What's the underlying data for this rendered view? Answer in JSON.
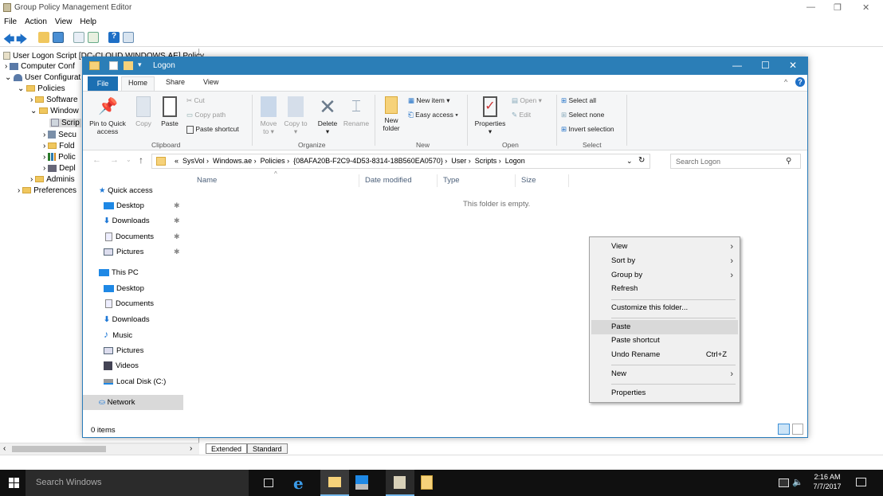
{
  "gpm": {
    "title": "Group Policy Management Editor",
    "menu": [
      "File",
      "Action",
      "View",
      "Help"
    ],
    "tree": {
      "root": "User Logon Script [DC-CLOUD.WINDOWS.AE] Policy",
      "computer_config": "Computer Conf",
      "user_config": "User Configurat",
      "policies": "Policies",
      "software": "Software",
      "windows": "Window",
      "scripts": "Scrip",
      "security": "Secu",
      "folder": "Fold",
      "policy": "Polic",
      "deployed": "Depl",
      "admin": "Adminis",
      "preferences": "Preferences"
    },
    "tabs": {
      "extended": "Extended",
      "standard": "Standard"
    }
  },
  "explorer": {
    "title": "Logon",
    "tabs": {
      "file": "File",
      "home": "Home",
      "share": "Share",
      "view": "View"
    },
    "ribbon": {
      "pin": "Pin to Quick access",
      "copy": "Copy",
      "paste": "Paste",
      "cut": "Cut",
      "copy_path": "Copy path",
      "paste_shortcut": "Paste shortcut",
      "move_to": "Move to",
      "copy_to": "Copy to",
      "delete": "Delete",
      "rename": "Rename",
      "new_folder": "New folder",
      "new_item": "New item",
      "easy_access": "Easy access",
      "properties": "Properties",
      "open": "Open",
      "edit": "Edit",
      "select_all": "Select all",
      "select_none": "Select none",
      "invert_selection": "Invert selection",
      "groups": {
        "clipboard": "Clipboard",
        "organize": "Organize",
        "new": "New",
        "open": "Open",
        "select": "Select"
      }
    },
    "address": {
      "prefix": "«",
      "path": [
        "SysVol",
        "Windows.ae",
        "Policies",
        "{08AFA20B-F2C9-4D53-8314-18B560EA0570}",
        "User",
        "Scripts",
        "Logon"
      ]
    },
    "search_placeholder": "Search Logon",
    "nav": {
      "quick_access": "Quick access",
      "desktop": "Desktop",
      "downloads": "Downloads",
      "documents": "Documents",
      "pictures": "Pictures",
      "this_pc": "This PC",
      "pc_desktop": "Desktop",
      "pc_documents": "Documents",
      "pc_downloads": "Downloads",
      "music": "Music",
      "pc_pictures": "Pictures",
      "videos": "Videos",
      "local_disk": "Local Disk (C:)",
      "network": "Network"
    },
    "columns": {
      "name": "Name",
      "date_modified": "Date modified",
      "type": "Type",
      "size": "Size"
    },
    "empty_message": "This folder is empty.",
    "status": "0 items"
  },
  "context_menu": {
    "view": "View",
    "sort_by": "Sort by",
    "group_by": "Group by",
    "refresh": "Refresh",
    "customize": "Customize this folder...",
    "paste": "Paste",
    "paste_shortcut": "Paste shortcut",
    "undo_rename": "Undo Rename",
    "undo_shortcut": "Ctrl+Z",
    "new": "New",
    "properties": "Properties"
  },
  "taskbar": {
    "search_placeholder": "Search Windows",
    "time": "2:16 AM",
    "date": "7/7/2017"
  },
  "colors": {
    "accent": "#2b7eb7",
    "file_tab": "#1b6fb2",
    "taskbar": "#101010"
  }
}
